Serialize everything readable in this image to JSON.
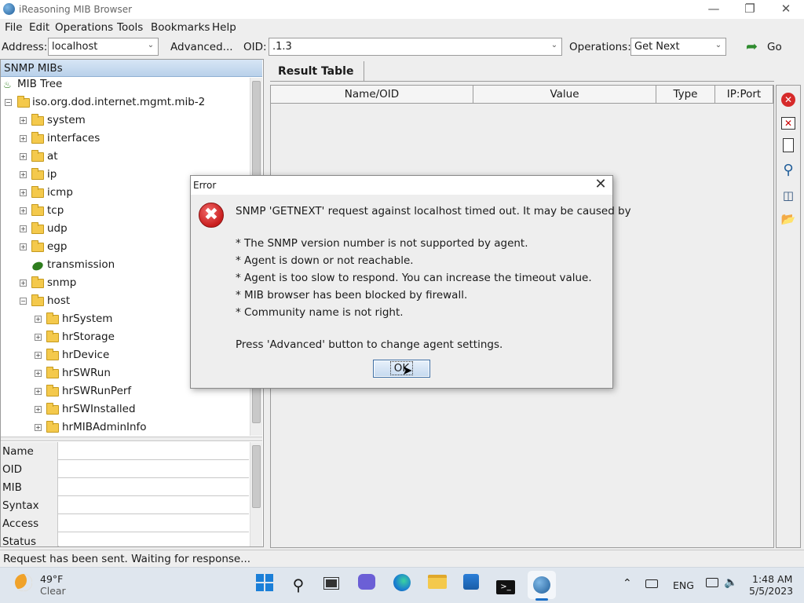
{
  "window": {
    "title": "iReasoning MIB Browser"
  },
  "menu": [
    "File",
    "Edit",
    "Operations",
    "Tools",
    "Bookmarks",
    "Help"
  ],
  "toolbar": {
    "address_label": "Address:",
    "address_value": "localhost",
    "advanced_label": "Advanced...",
    "oid_label": "OID:",
    "oid_value": ".1.3",
    "operations_label": "Operations:",
    "operations_value": "Get Next",
    "go_label": "Go"
  },
  "left_panel": {
    "header": "SNMP MIBs",
    "tree": {
      "root": "MIB Tree",
      "mib2": "iso.org.dod.internet.mgmt.mib-2",
      "items": [
        "system",
        "interfaces",
        "at",
        "ip",
        "icmp",
        "tcp",
        "udp",
        "egp",
        "transmission",
        "snmp",
        "host"
      ],
      "host_children": [
        "hrSystem",
        "hrStorage",
        "hrDevice",
        "hrSWRun",
        "hrSWRunPerf",
        "hrSWInstalled",
        "hrMIBAdminInfo"
      ]
    },
    "properties": [
      "Name",
      "OID",
      "MIB",
      "Syntax",
      "Access",
      "Status"
    ]
  },
  "result": {
    "tab": "Result Table",
    "columns": [
      "Name/OID",
      "Value",
      "Type",
      "IP:Port"
    ]
  },
  "status_text": "Request has been sent. Waiting for response...",
  "dialog": {
    "title": "Error",
    "line1": "SNMP 'GETNEXT' request against localhost timed out. It may be caused by",
    "bullets": [
      "* The SNMP version number is not supported by agent.",
      "* Agent is down or not reachable.",
      "* Agent is too slow to respond. You can increase the timeout value.",
      "* MIB browser has been blocked by firewall.",
      "* Community name is not right."
    ],
    "hint": "Press 'Advanced' button to change agent settings.",
    "ok_label": "OK"
  },
  "taskbar": {
    "weather_temp": "49°F",
    "weather_desc": "Clear",
    "lang": "ENG",
    "time": "1:48 AM",
    "date": "5/5/2023"
  },
  "icons": {
    "app": "globe-icon",
    "error": "error-x-icon",
    "go": "green-arrow-icon"
  },
  "colors": {
    "error_red": "#c81e1e",
    "folder_yellow": "#f4c94c",
    "header_blue": "#b9d1ea"
  }
}
